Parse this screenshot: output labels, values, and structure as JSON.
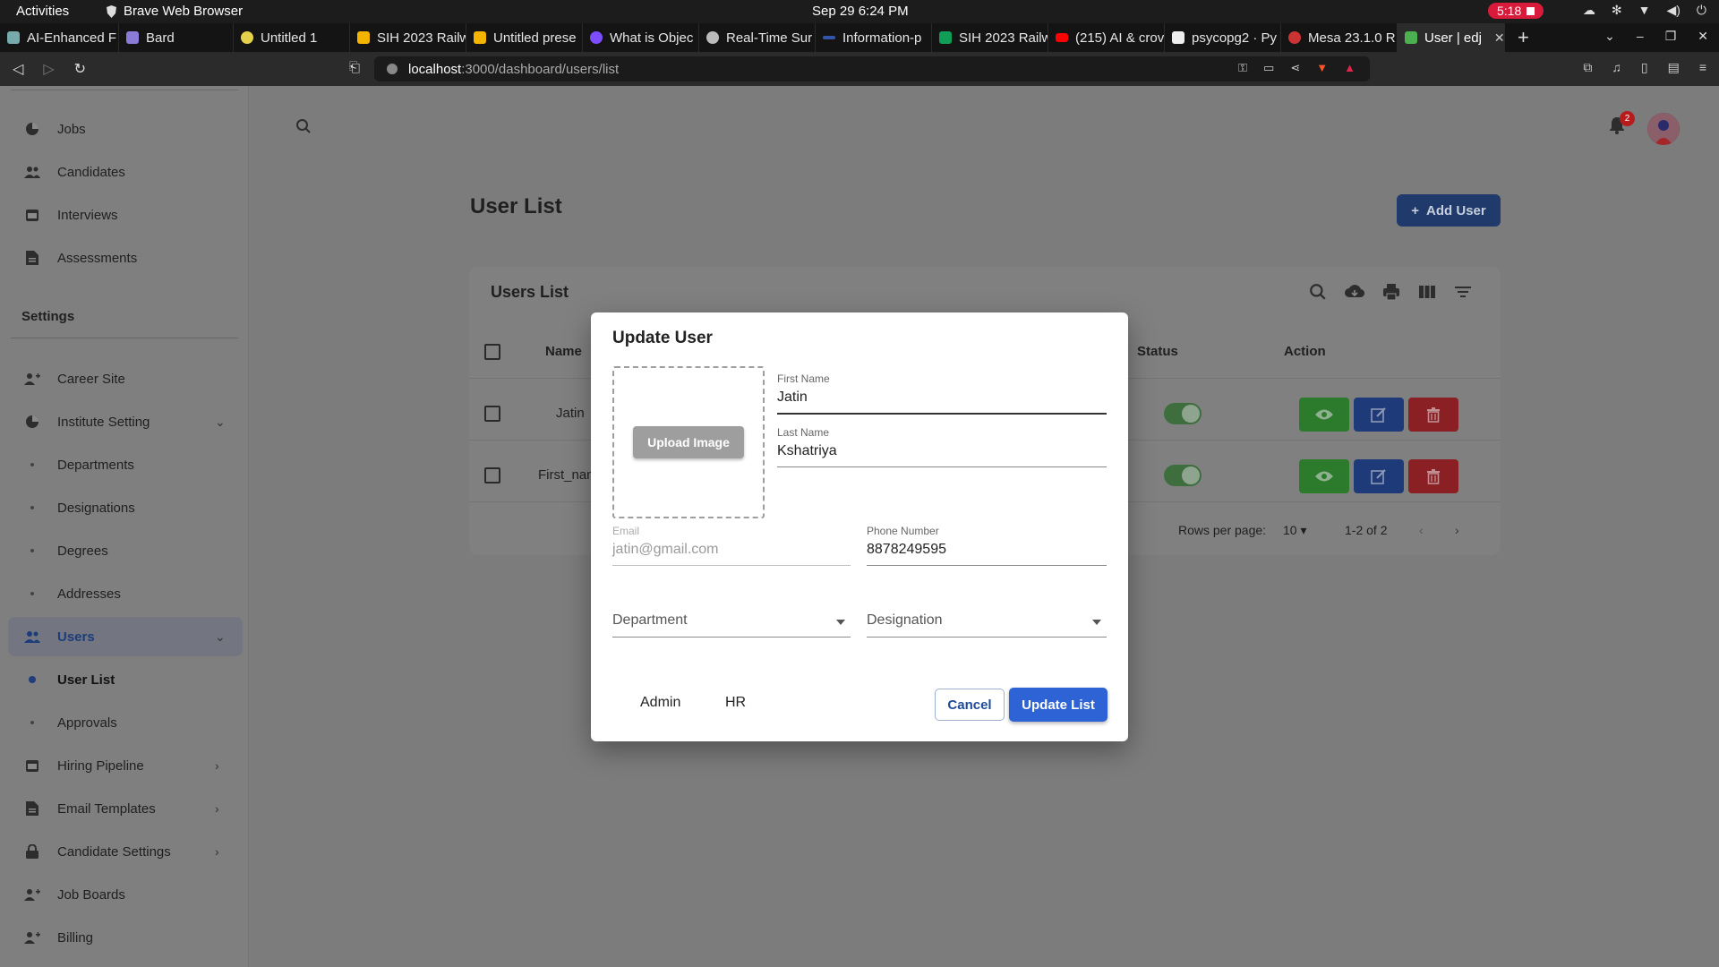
{
  "system_bar": {
    "activities": "Activities",
    "app_name": "Brave Web Browser",
    "clock": "Sep 29  6:24 PM",
    "recording_time": "5:18"
  },
  "tabs": [
    {
      "title": "AI-Enhanced F",
      "fav_color": "#7aa"
    },
    {
      "title": "Bard",
      "fav_color": "#8a7bd9"
    },
    {
      "title": "Untitled 1",
      "fav_color": "#e5d04a"
    },
    {
      "title": "SIH 2023 Railw",
      "fav_color": "#f4b400"
    },
    {
      "title": "Untitled prese",
      "fav_color": "#f4b400"
    },
    {
      "title": "What is Objec",
      "fav_color": "#7c4dff"
    },
    {
      "title": "Real-Time Sur",
      "fav_color": "#bbbbbb"
    },
    {
      "title": "Information-p",
      "fav_color": "#3355aa"
    },
    {
      "title": "SIH 2023 Railw",
      "fav_color": "#0f9d58"
    },
    {
      "title": "(215) AI & crov",
      "fav_color": "#ff0000"
    },
    {
      "title": "psycopg2 · Py",
      "fav_color": "#eeeeee"
    },
    {
      "title": "Mesa 23.1.0 R",
      "fav_color": "#cc3333"
    },
    {
      "title": "User | edj",
      "fav_color": "#4caf50"
    }
  ],
  "address_bar": {
    "host": "localhost",
    "path": ":3000/dashboard/users/list"
  },
  "sidebar": {
    "top_items": [
      {
        "label": "Jobs",
        "icon": "pie-chart-icon"
      },
      {
        "label": "Candidates",
        "icon": "people-icon"
      },
      {
        "label": "Interviews",
        "icon": "calendar-icon"
      },
      {
        "label": "Assessments",
        "icon": "document-icon"
      }
    ],
    "settings_heading": "Settings",
    "settings_items": [
      {
        "label": "Career Site"
      },
      {
        "label": "Institute Setting"
      },
      {
        "label": "Departments"
      },
      {
        "label": "Designations"
      },
      {
        "label": "Degrees"
      },
      {
        "label": "Addresses"
      },
      {
        "label": "Users"
      },
      {
        "label": "User List"
      },
      {
        "label": "Approvals"
      },
      {
        "label": "Hiring Pipeline"
      },
      {
        "label": "Email Templates"
      },
      {
        "label": "Candidate Settings"
      },
      {
        "label": "Job Boards"
      },
      {
        "label": "Billing"
      }
    ]
  },
  "header": {
    "notification_count": "2"
  },
  "main": {
    "page_title": "User List",
    "add_user_label": "Add User",
    "card_title": "Users List",
    "columns": {
      "name": "Name",
      "status": "Status",
      "action": "Action"
    },
    "rows": [
      {
        "name": "Jatin",
        "status_on": true
      },
      {
        "name": "First_nam",
        "status_on": true
      }
    ],
    "rows_per_page_label": "Rows per page:",
    "rows_per_page_value": "10",
    "range_label": "1-2 of 2"
  },
  "modal": {
    "title": "Update User",
    "upload_label": "Upload Image",
    "first_name_label": "First Name",
    "first_name_value": "Jatin",
    "last_name_label": "Last Name",
    "last_name_value": "Kshatriya",
    "email_label": "Email",
    "email_value": "jatin@gmail.com",
    "phone_label": "Phone Number",
    "phone_value": "8878249595",
    "department_placeholder": "Department",
    "designation_placeholder": "Designation",
    "role_tabs": [
      "Admin",
      "HR"
    ],
    "cancel_label": "Cancel",
    "submit_label": "Update List"
  }
}
